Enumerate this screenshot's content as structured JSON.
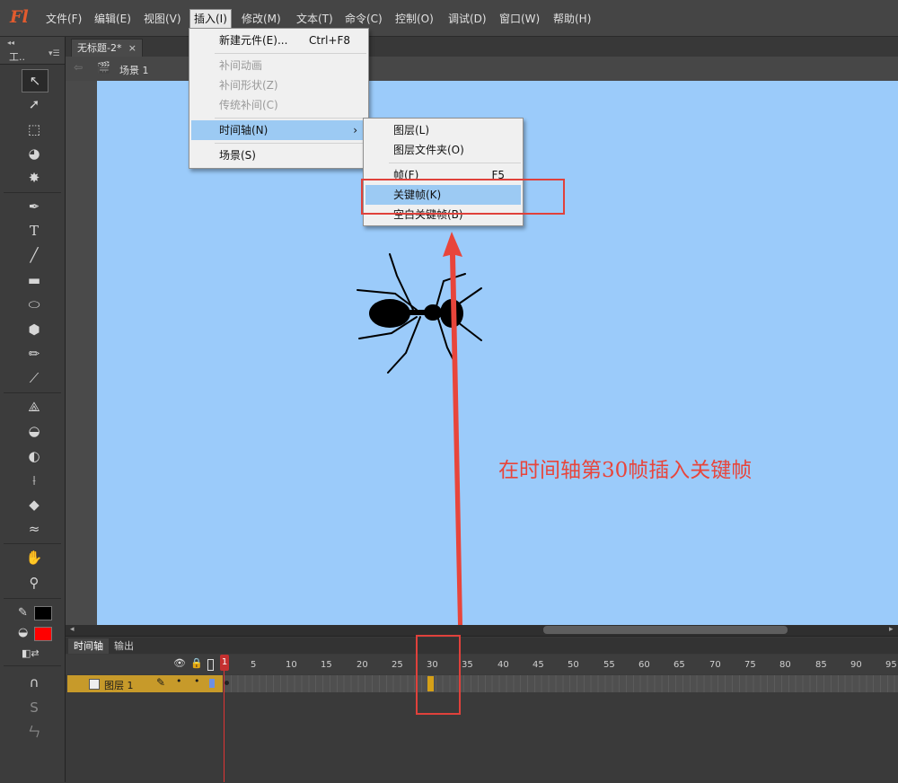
{
  "app": {
    "logo": "Fl"
  },
  "menubar": {
    "items": [
      "文件(F)",
      "编辑(E)",
      "视图(V)",
      "插入(I)",
      "修改(M)",
      "文本(T)",
      "命令(C)",
      "控制(O)",
      "调试(D)",
      "窗口(W)",
      "帮助(H)"
    ],
    "active_index": 3
  },
  "toolbar": {
    "title": "工..",
    "stroke_color": "#000000",
    "fill_color": "#ff0000"
  },
  "document": {
    "tab_title": "无标题-2*",
    "close_glyph": "×",
    "scene_label": "场景 1"
  },
  "insert_menu": {
    "items": [
      {
        "label": "新建元件(E)...",
        "shortcut": "Ctrl+F8",
        "enabled": true
      },
      {
        "label": "补间动画",
        "enabled": false
      },
      {
        "label": "补间形状(Z)",
        "enabled": false
      },
      {
        "label": "传统补间(C)",
        "enabled": false
      },
      {
        "label": "时间轴(N)",
        "enabled": true,
        "submenu": true
      },
      {
        "label": "场景(S)",
        "enabled": true
      }
    ]
  },
  "timeline_submenu": {
    "items": [
      {
        "label": "图层(L)"
      },
      {
        "label": "图层文件夹(O)"
      },
      {
        "label": "帧(F)",
        "shortcut": "F5"
      },
      {
        "label": "关键帧(K)",
        "highlighted": true
      },
      {
        "label": "空白关键帧(B)"
      }
    ]
  },
  "stage": {
    "background": "#9bcbfa",
    "instruction": "在时间轴第30帧插入关键帧"
  },
  "timeline": {
    "tabs": [
      "时间轴",
      "输出"
    ],
    "frame_numbers": [
      "1",
      "5",
      "10",
      "15",
      "20",
      "25",
      "30",
      "35",
      "40",
      "45",
      "50",
      "55",
      "60",
      "65",
      "70",
      "75",
      "80",
      "85",
      "90",
      "95"
    ],
    "playhead_frame": "1",
    "layer_name": "图层 1",
    "keyframe_at": 30
  }
}
